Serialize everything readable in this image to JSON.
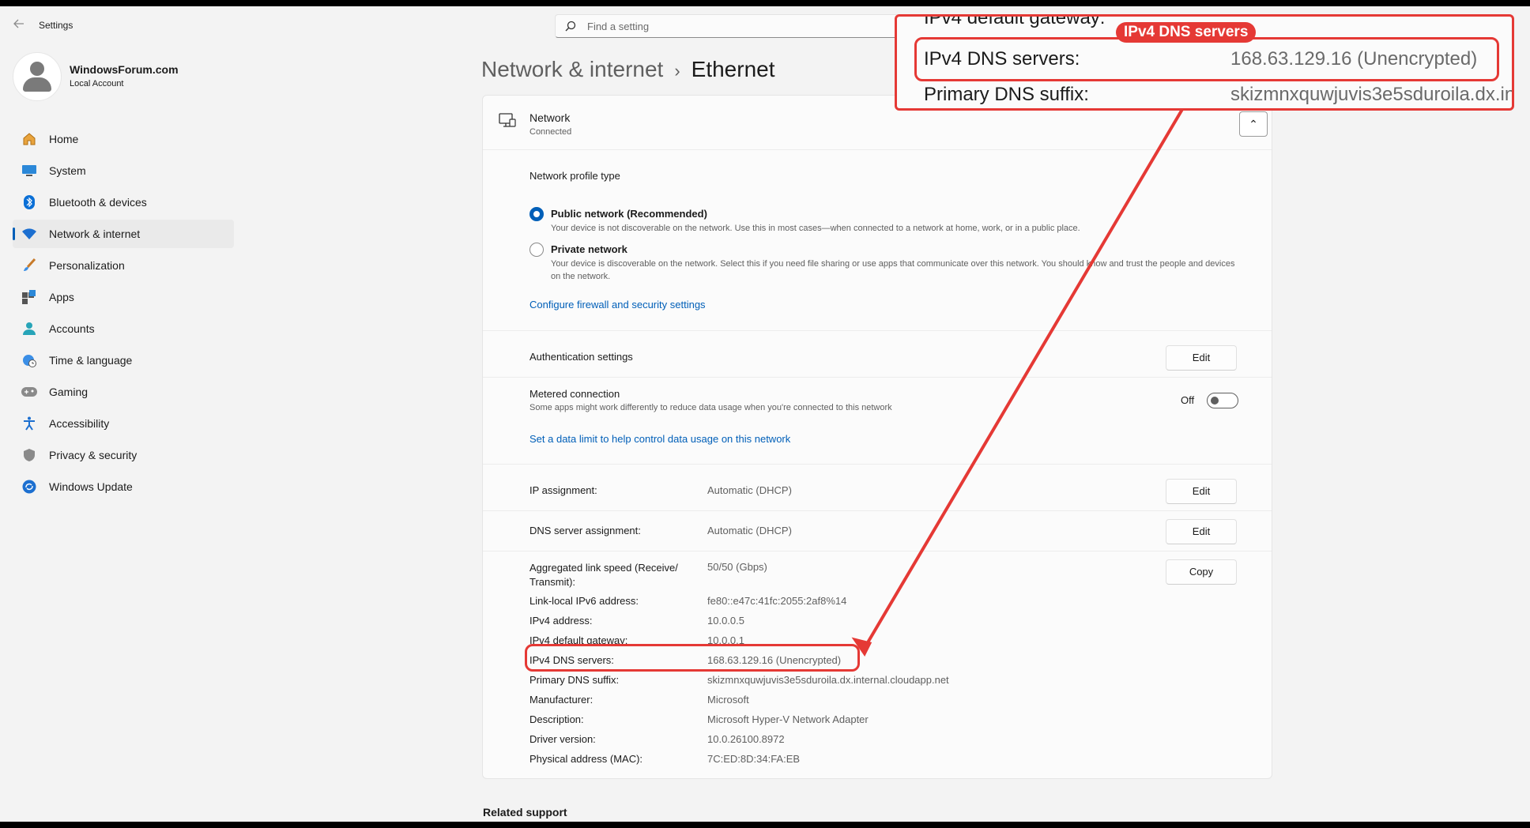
{
  "app": {
    "title": "Settings"
  },
  "search": {
    "placeholder": "Find a setting"
  },
  "user": {
    "name": "WindowsForum.com",
    "account_type": "Local Account"
  },
  "nav": {
    "items": [
      {
        "label": "Home",
        "icon": "home-icon"
      },
      {
        "label": "System",
        "icon": "system-icon"
      },
      {
        "label": "Bluetooth & devices",
        "icon": "bluetooth-icon"
      },
      {
        "label": "Network & internet",
        "icon": "wifi-icon",
        "active": true
      },
      {
        "label": "Personalization",
        "icon": "brush-icon"
      },
      {
        "label": "Apps",
        "icon": "apps-icon"
      },
      {
        "label": "Accounts",
        "icon": "accounts-icon"
      },
      {
        "label": "Time & language",
        "icon": "globe-clock-icon"
      },
      {
        "label": "Gaming",
        "icon": "gamepad-icon"
      },
      {
        "label": "Accessibility",
        "icon": "accessibility-icon"
      },
      {
        "label": "Privacy & security",
        "icon": "shield-icon"
      },
      {
        "label": "Windows Update",
        "icon": "update-icon"
      }
    ]
  },
  "breadcrumb": {
    "parent": "Network & internet",
    "separator": "›",
    "current": "Ethernet"
  },
  "network": {
    "name": "Network",
    "status": "Connected",
    "profile_type_label": "Network profile type",
    "public": {
      "label": "Public network (Recommended)",
      "description": "Your device is not discoverable on the network. Use this in most cases—when connected to a network at home, work, or in a public place."
    },
    "private": {
      "label": "Private network",
      "description": "Your device is discoverable on the network. Select this if you need file sharing or use apps that communicate over this network. You should know and trust the people and devices on the network."
    },
    "firewall_link": "Configure firewall and security settings",
    "auth_label": "Authentication settings",
    "edit_label": "Edit",
    "metered": {
      "label": "Metered connection",
      "description": "Some apps might work differently to reduce data usage when you're connected to this network",
      "state": "Off"
    },
    "data_limit_link": "Set a data limit to help control data usage on this network",
    "ip_assignment": {
      "label": "IP assignment:",
      "value": "Automatic (DHCP)"
    },
    "dns_assignment": {
      "label": "DNS server assignment:",
      "value": "Automatic (DHCP)"
    },
    "copy_label": "Copy",
    "properties": [
      {
        "label": "Aggregated link speed (Receive/ Transmit):",
        "value": "50/50 (Gbps)"
      },
      {
        "label": "Link-local IPv6 address:",
        "value": "fe80::e47c:41fc:2055:2af8%14"
      },
      {
        "label": "IPv4 address:",
        "value": "10.0.0.5"
      },
      {
        "label": "IPv4 default gateway:",
        "value": "10.0.0.1"
      },
      {
        "label": "IPv4 DNS servers:",
        "value": "168.63.129.16 (Unencrypted)"
      },
      {
        "label": "Primary DNS suffix:",
        "value": "skizmnxquwjuvis3e5sduroila.dx.internal.cloudapp.net"
      },
      {
        "label": "Manufacturer:",
        "value": "Microsoft"
      },
      {
        "label": "Description:",
        "value": "Microsoft Hyper-V Network Adapter"
      },
      {
        "label": "Driver version:",
        "value": "10.0.26100.8972"
      },
      {
        "label": "Physical address (MAC):",
        "value": "7C:ED:8D:34:FA:EB"
      }
    ]
  },
  "related_support": "Related support",
  "callout": {
    "badge": "IPv4 DNS servers",
    "prev_label": "IPv4 default gateway:",
    "main_label": "IPv4 DNS servers:",
    "main_value": "168.63.129.16 (Unencrypted)",
    "next_label": "Primary DNS suffix:",
    "next_value": "skizmnxquwjuvis3e5sduroila.dx.in",
    "color": "#e53935"
  }
}
